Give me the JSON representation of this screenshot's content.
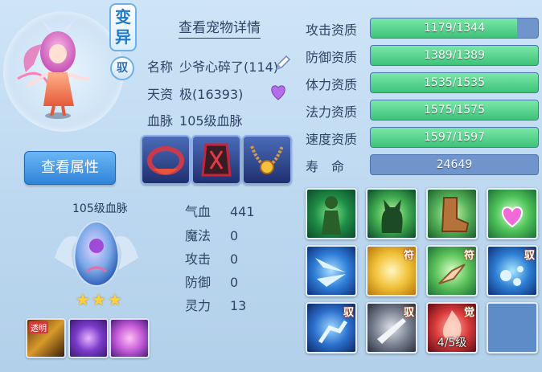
{
  "pet": {
    "mutate_badge": [
      "变",
      "异"
    ],
    "tame_badge": "驭",
    "view_detail": "查看宠物详情",
    "name_label": "名称",
    "name_value": "少爷心碎了(114)",
    "aptitude_label": "天资",
    "aptitude_value": "极(16393)",
    "bloodline_label": "血脉",
    "bloodline_value": "105级血脉"
  },
  "buttons": {
    "view_attributes": "查看属性"
  },
  "bloodline_panel": {
    "title": "105级血脉",
    "stars": 3
  },
  "small_skills": [
    {
      "name": "tattered",
      "tag": "透明"
    },
    {
      "name": "flower"
    },
    {
      "name": "crystal"
    }
  ],
  "stats": [
    {
      "label": "气血",
      "value": "441"
    },
    {
      "label": "魔法",
      "value": "0"
    },
    {
      "label": "攻击",
      "value": "0"
    },
    {
      "label": "防御",
      "value": "0"
    },
    {
      "label": "灵力",
      "value": "13"
    }
  ],
  "qualities": [
    {
      "label": "攻击资质",
      "text": "1179/1344",
      "fill": 0.877
    },
    {
      "label": "防御资质",
      "text": "1389/1389",
      "fill": 1.0
    },
    {
      "label": "体力资质",
      "text": "1535/1535",
      "fill": 1.0
    },
    {
      "label": "法力资质",
      "text": "1575/1575",
      "fill": 1.0
    },
    {
      "label": "速度资质",
      "text": "1597/1597",
      "fill": 1.0
    },
    {
      "label": "寿　命",
      "text": "24649",
      "fill": 0
    }
  ],
  "skills": [
    {
      "name": "green-figure",
      "tag": ""
    },
    {
      "name": "cat",
      "tag": ""
    },
    {
      "name": "boot",
      "tag": ""
    },
    {
      "name": "heart-crystal",
      "tag": ""
    },
    {
      "name": "wings",
      "tag": ""
    },
    {
      "name": "burst",
      "tag": "符"
    },
    {
      "name": "pointing-hand",
      "tag": "符"
    },
    {
      "name": "orbs",
      "tag": "驭"
    },
    {
      "name": "runner",
      "tag": "驭"
    },
    {
      "name": "blades",
      "tag": "驭"
    },
    {
      "name": "flame",
      "tag": "觉",
      "level": "4/5级"
    },
    {
      "name": "empty",
      "tag": ""
    }
  ],
  "colors": {
    "accent": "#2f84d9",
    "bar_fill": "#3fc27a",
    "bar_bg": "#6f95cc",
    "star": "#ffd23a"
  }
}
